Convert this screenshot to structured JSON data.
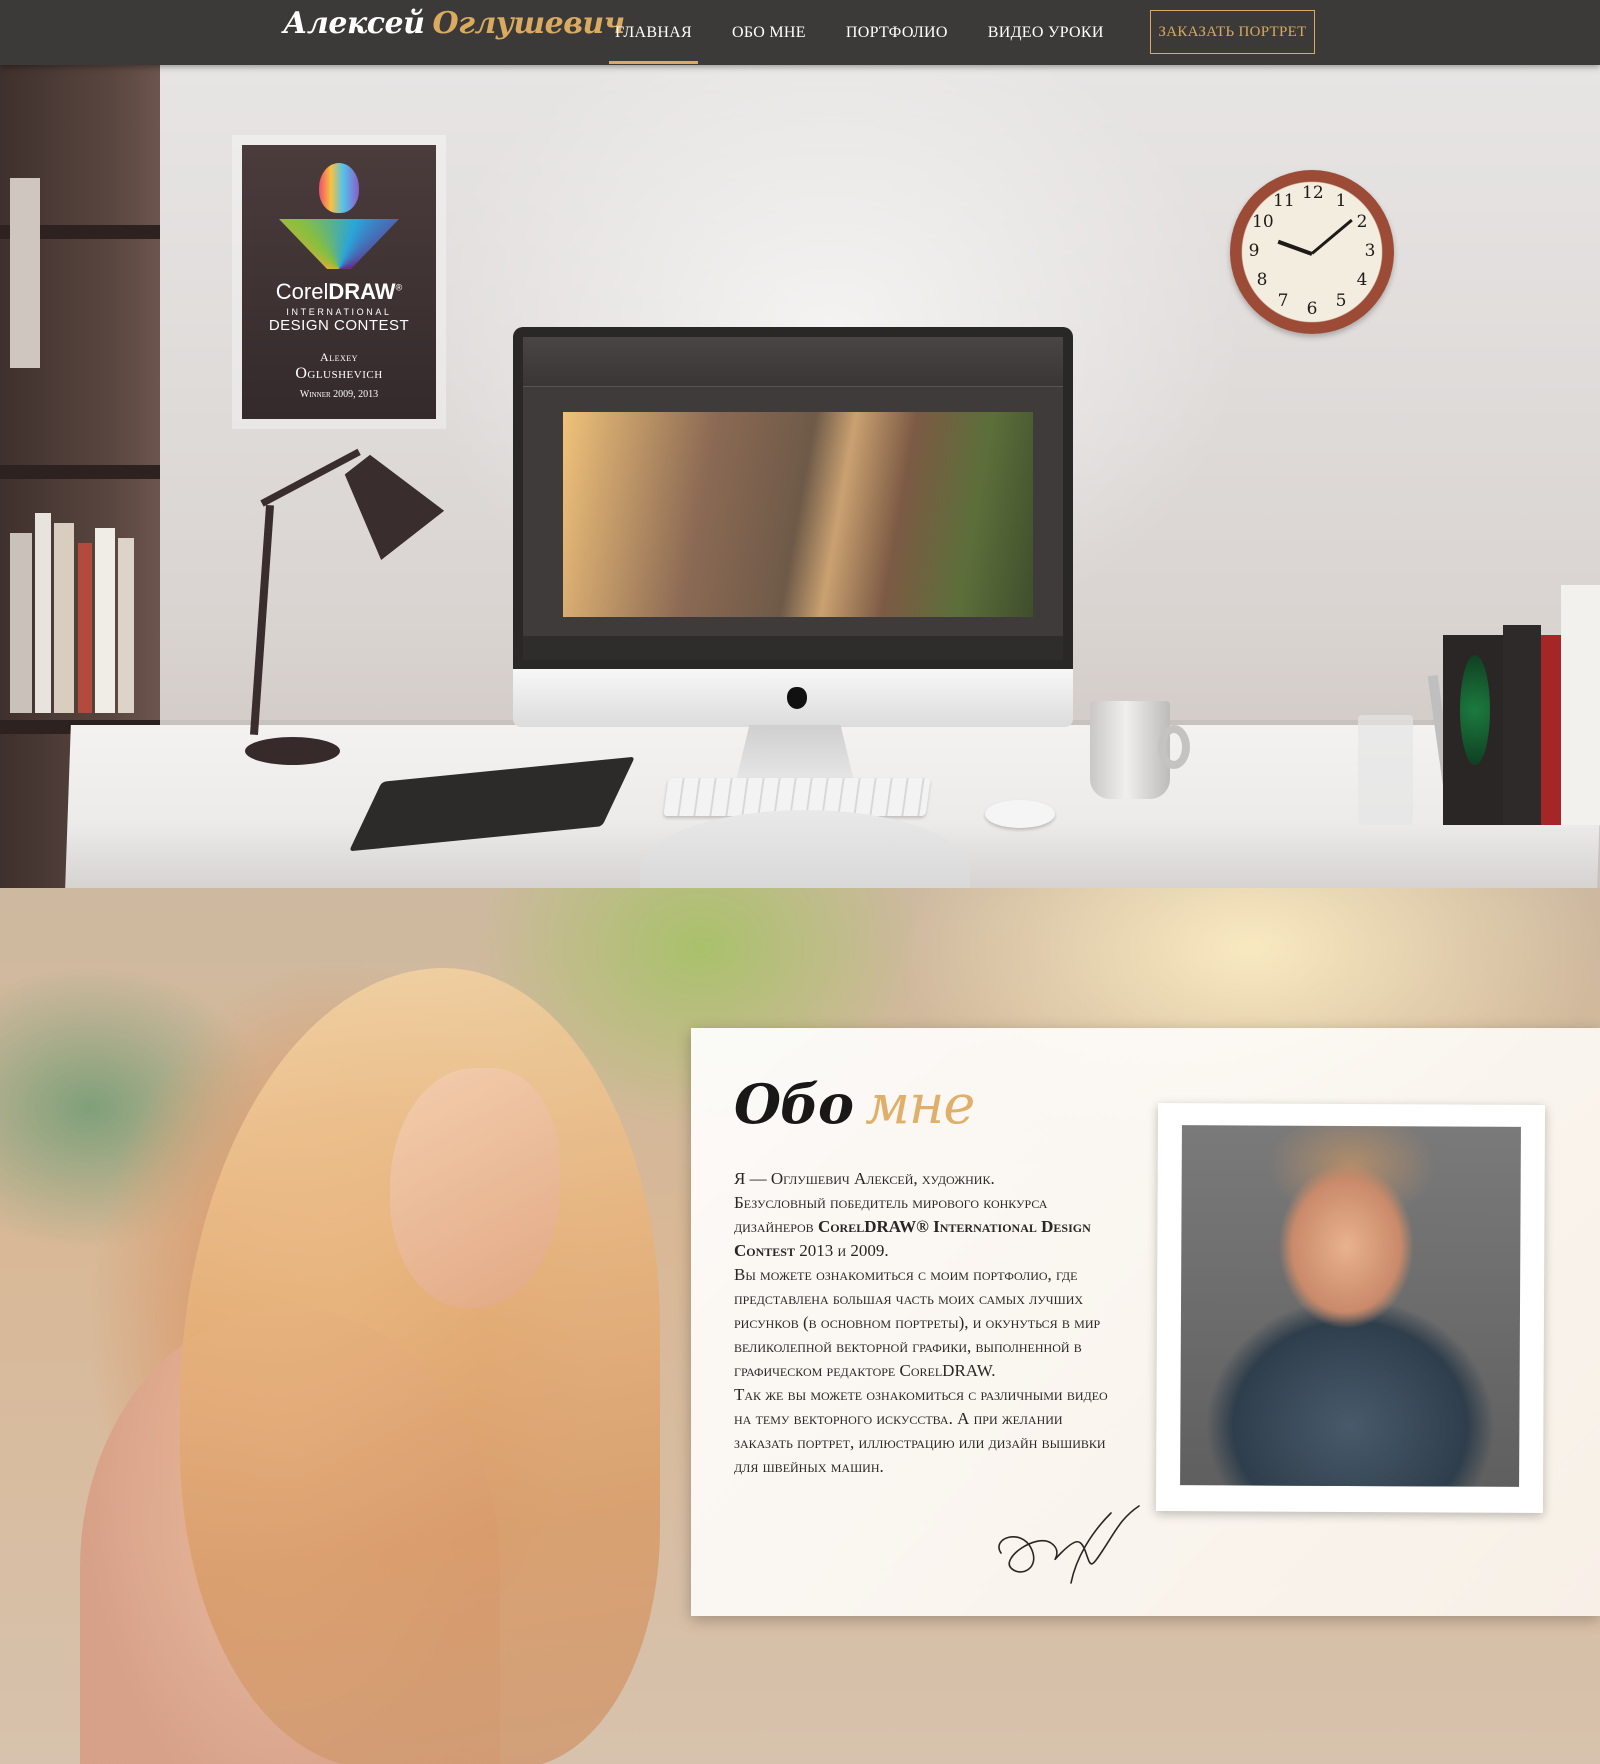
{
  "header": {
    "logo_first": "Алексей",
    "logo_last": "Оглушевич",
    "nav": [
      {
        "label": "ГЛАВНАЯ",
        "active": true
      },
      {
        "label": "ОБО МНЕ",
        "active": false
      },
      {
        "label": "ПОРТФОЛИО",
        "active": false
      },
      {
        "label": "ВИДЕО УРОКИ",
        "active": false
      }
    ],
    "order_button": "ЗАКАЗАТЬ ПОРТРЕТ"
  },
  "hero": {
    "award": {
      "brand_light": "Corel",
      "brand_bold": "DRAW",
      "brand_mark": "®",
      "line1": "INTERNATIONAL",
      "line2": "DESIGN CONTEST",
      "name_first": "Alexey",
      "name_last": "Oglushevich",
      "winner": "Winner 2009, 2013"
    },
    "clock_numbers": [
      "12",
      "1",
      "2",
      "3",
      "4",
      "5",
      "6",
      "7",
      "8",
      "9",
      "10",
      "11"
    ]
  },
  "about": {
    "title_part1": "Обо",
    "title_part2": "мне",
    "p1": "Я — Оглушевич Алексей, художник.",
    "p2_a": "Безусловный победитель мирового конкурса дизайнеров ",
    "p2_b": "CorelDRAW® International Design Contest",
    "p2_c": " 2013 и 2009.",
    "p3": "Вы можете ознакомиться с моим портфолио, где представлена большая часть моих самых лучших рисунков (в основном портреты), и окунуться в мир великолепной векторной графики, выполненной в графическом редакторе CorelDRAW.",
    "p4": "Так же вы можете ознакомиться с различными видео на тему векторного искусства. А при желании заказать портрет, иллюстрацию или дизайн вышивки для швейных машин."
  },
  "colors": {
    "header_bg": "#3b3a38",
    "accent_gold": "#d9aa5f",
    "text_dark": "#2a2624"
  }
}
